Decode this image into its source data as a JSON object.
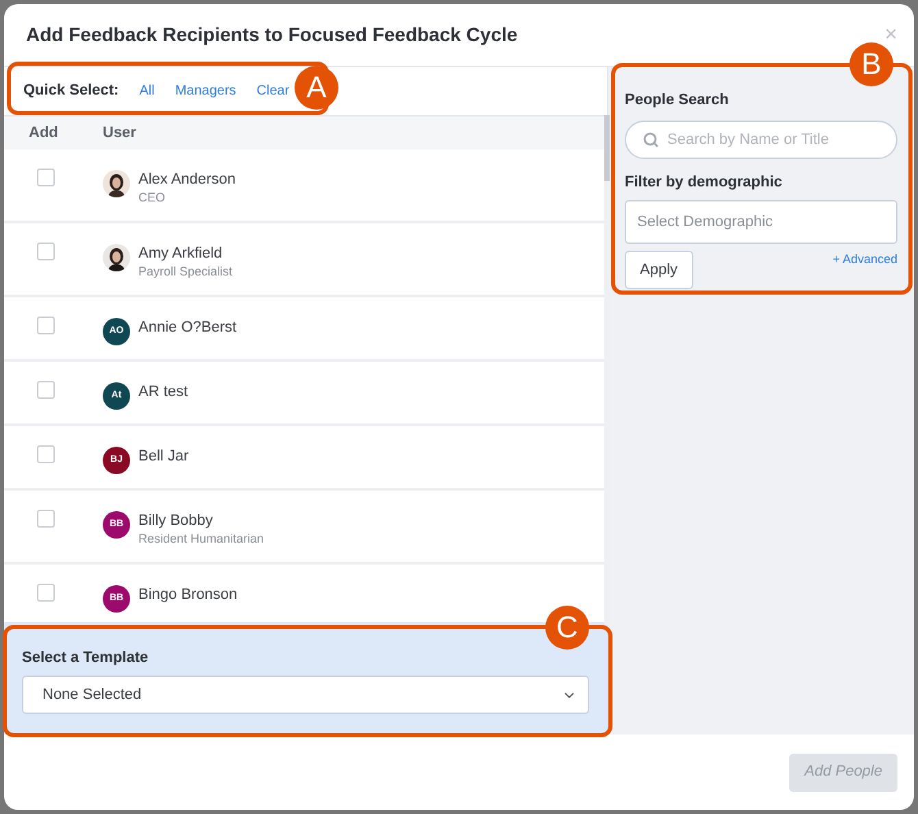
{
  "dialog": {
    "title": "Add Feedback Recipients to Focused Feedback Cycle",
    "close": "×"
  },
  "quick_select": {
    "label": "Quick Select:",
    "links": [
      "All",
      "Managers",
      "Clear"
    ]
  },
  "table": {
    "columns": [
      "Add",
      "User"
    ],
    "rows": [
      {
        "checked": false,
        "name": "Alex Anderson",
        "title": "CEO"
      },
      {
        "checked": false,
        "name": "Amy Arkfield",
        "title": "Payroll Specialist"
      },
      {
        "checked": false,
        "avatar": {
          "kind": "initials",
          "text": "AO",
          "color": "#0f4752"
        },
        "name": "Annie O?Berst"
      },
      {
        "checked": false,
        "avatar": {
          "kind": "initials",
          "text": "At",
          "color": "#0f4752"
        },
        "name": "AR test"
      },
      {
        "checked": false,
        "avatar": {
          "kind": "initials",
          "text": "BJ",
          "color": "#8b0a23"
        },
        "name": "Bell Jar"
      },
      {
        "checked": false,
        "avatar": {
          "kind": "initials",
          "text": "BB",
          "color": "#9c0b6b"
        },
        "name": "Billy Bobby",
        "title": "Resident Humanitarian"
      },
      {
        "checked": false,
        "avatar": {
          "kind": "initials",
          "text": "BB",
          "color": "#9c0b6b"
        },
        "name": "Bingo Bronson"
      }
    ]
  },
  "template": {
    "label": "Select a Template",
    "value": "None Selected"
  },
  "search": {
    "label": "People Search",
    "placeholder": "Search by Name or Title",
    "filter_label": "Filter by demographic",
    "filter_placeholder": "Select Demographic",
    "apply": "Apply",
    "advanced": "+ Advanced"
  },
  "footer": {
    "button": "Add People",
    "disabled": true
  },
  "callouts": [
    "A",
    "B",
    "C"
  ]
}
